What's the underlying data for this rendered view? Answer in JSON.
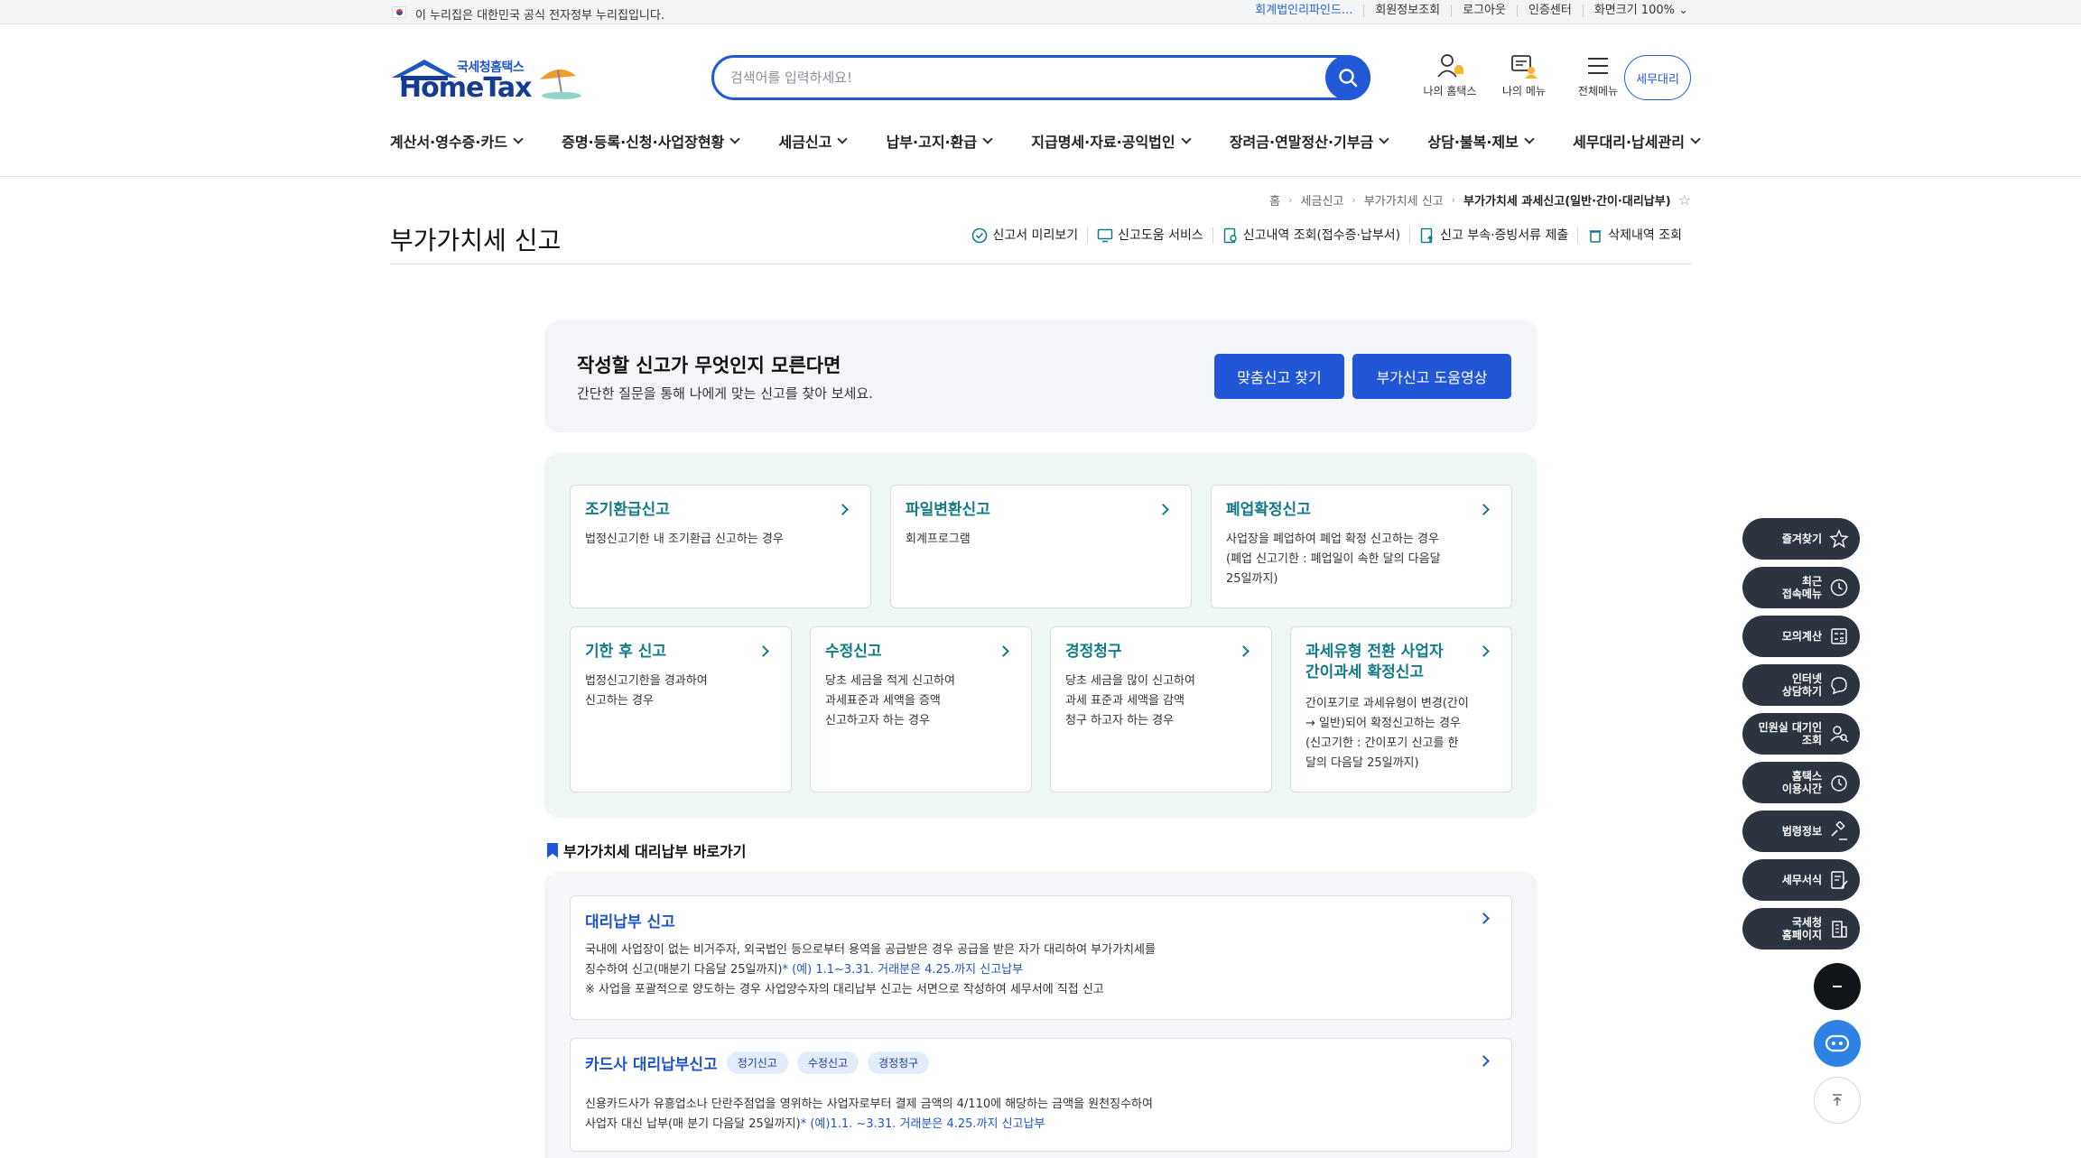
{
  "gov_bar": {
    "notice": "이 누리집은 대한민국 공식 전자정부 누리집입니다.",
    "links": [
      "회계법인리파인드...",
      "회원정보조회",
      "로그아웃",
      "인증센터"
    ],
    "zoom_label": "화면크기 100%"
  },
  "header": {
    "logo_sub": "국세청홈택스",
    "logo_main": "HomeTax",
    "search_placeholder": "검색어를 입력하세요!",
    "icons": [
      {
        "label": "나의 홈택스",
        "icon": "user-bell-icon"
      },
      {
        "label": "나의 메뉴",
        "icon": "my-menu-icon"
      },
      {
        "label": "전체메뉴",
        "icon": "hamburger-icon"
      }
    ],
    "tax_agent_label": "세무대리"
  },
  "gnb": [
    "계산서·영수증·카드",
    "증명·등록·신청·사업장현황",
    "세금신고",
    "납부·고지·환급",
    "지급명세·자료·공익법인",
    "장려금·연말정산·기부금",
    "상담·불복·제보",
    "세무대리·납세관리"
  ],
  "breadcrumb": [
    "홈",
    "세금신고",
    "부가가치세 신고",
    "부가가치세 과세신고(일반·간이·대리납부)"
  ],
  "page_title": "부가가치세 신고",
  "quick_links": [
    "신고서 미리보기",
    "신고도움 서비스",
    "신고내역 조회(접수증·납부서)",
    "신고 부속·증빙서류 제출",
    "삭제내역 조회"
  ],
  "helper": {
    "title": "작성할 신고가 무엇인지 모른다면",
    "desc": "간단한 질문을 통해 나에게 맞는 신고를 찾아 보세요.",
    "btn_find": "맞춤신고 찾기",
    "btn_video": "부가신고 도움영상"
  },
  "report_types": [
    {
      "title": "조기환급신고",
      "desc": [
        "법정신고기한 내 조기환급 신고하는 경우"
      ]
    },
    {
      "title": "파일변환신고",
      "desc": [
        "회계프로그램"
      ]
    },
    {
      "title": "폐업확정신고",
      "desc": [
        "사업장을 폐업하여 폐업 확정 신고하는 경우",
        "(폐업 신고기한 : 폐업일이 속한 달의 다음달",
        "25일까지)"
      ]
    },
    {
      "title": "기한 후 신고",
      "desc": [
        "법정신고기한을 경과하여",
        "신고하는 경우"
      ]
    },
    {
      "title": "수정신고",
      "desc": [
        "당초 세금을 적게 신고하여",
        "과세표준과 세액을 증액",
        "신고하고자 하는 경우"
      ]
    },
    {
      "title": "경정청구",
      "desc": [
        "당초 세금을 많이 신고하여",
        "과세 표준과 세액을 감액",
        "청구 하고자 하는 경우"
      ]
    },
    {
      "title": [
        "과세유형 전환 사업자",
        "간이과세 확정신고"
      ],
      "desc": [
        "간이포기로 과세유형이 변경(간이",
        "→ 일반)되어 확정신고하는 경우",
        "(신고기한 : 간이포기 신고를 한",
        "달의 다음달 25일까지)"
      ]
    }
  ],
  "proxy_section": {
    "heading": "부가가치세 대리납부 바로가기",
    "cards": [
      {
        "title": "대리납부 신고",
        "lines": [
          "국내에 사업장이 없는 비거주자, 외국법인 등으로부터 용역을 공급받은 경우 공급을 받은 자가 대리하여 부가가치세를",
          "징수하여 신고(매분기 다음달 25일까지)",
          "※ 사업을 포괄적으로 양도하는 경우 사업양수자의 대리납부 신고는 서면으로 작성하여 세무서에 직접 신고"
        ],
        "highlight": "* (예) 1.1~3.31. 거래분은 4.25.까지 신고납부"
      },
      {
        "title": "카드사 대리납부신고",
        "tags": [
          "정기신고",
          "수정신고",
          "경정청구"
        ],
        "lines": [
          "신용카드사가 유흥업소나 단란주점업을 영위하는 사업자로부터 결제 금액의 4/110에 해당하는 금액을 원천징수하여",
          "사업자 대신 납부(매 분기 다음달 25일까지)"
        ],
        "highlight": "* (예)1.1. ~3.31. 거래분은 4.25.까지 신고납부"
      }
    ]
  },
  "float_menu": [
    {
      "label": "즐겨찾기",
      "icon": "star-icon"
    },
    {
      "label": "최근\n접속메뉴",
      "icon": "clock-icon"
    },
    {
      "label": "모의계산",
      "icon": "calculator-icon"
    },
    {
      "label": "인터넷\n상담하기",
      "icon": "chat-icon"
    },
    {
      "label": "민원실 대기인\n조회",
      "icon": "person-search-icon"
    },
    {
      "label": "홈택스\n이용시간",
      "icon": "alarm-clock-icon"
    },
    {
      "label": "법령정보",
      "icon": "gavel-icon"
    },
    {
      "label": "세무서식",
      "icon": "form-edit-icon"
    },
    {
      "label": "국세청\n홈페이지",
      "icon": "building-icon"
    }
  ],
  "colors": {
    "primary": "#2157d6",
    "teal_title": "#137a88",
    "float_bg": "#2c3440",
    "bot_fab": "#2e82e6"
  }
}
